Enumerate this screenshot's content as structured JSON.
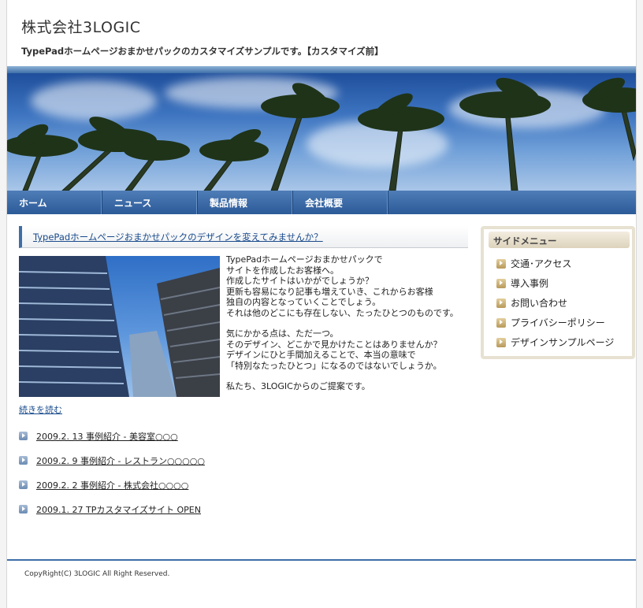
{
  "site": {
    "title": "株式会社3LOGIC",
    "description": "TypePadホームページおまかせパックのカスタマイズサンプルです。【カスタマイズ前】"
  },
  "nav": {
    "items": [
      {
        "label": "ホーム"
      },
      {
        "label": "ニュース"
      },
      {
        "label": "製品情報"
      },
      {
        "label": "会社概要"
      }
    ]
  },
  "post": {
    "title": "TypePadホームページおまかせパックのデザインを変えてみませんか？",
    "lines_p1": [
      "TypePadホームページおまかせパックで",
      "サイトを作成したお客様へ。",
      "作成したサイトはいかがでしょうか？",
      "更新も容易になり記事も増えていき、これからお客様",
      "独自の内容となっていくことでしょう。",
      "それは他のどこにも存在しない、たったひとつのものです。"
    ],
    "lines_p2": [
      "気にかかる点は、ただ一つ。",
      "そのデザイン、どこかで見かけたことはありませんか？",
      "デザインにひと手間加えることで、本当の意味で",
      "「特別なたったひとつ」になるのではないでしょうか。"
    ],
    "lines_p3": [
      "私たち、3LOGICからのご提案です。"
    ],
    "read_more": "続きを読む"
  },
  "news": [
    {
      "text": "2009.2. 13  事例紹介 - 美容室○○○"
    },
    {
      "text": "2009.2. 9   事例紹介 - レストラン○○○○○"
    },
    {
      "text": "2009.2. 2   事例紹介 - 株式会社○○○○"
    },
    {
      "text": "2009.1. 27  TPカスタマイズサイト  OPEN"
    }
  ],
  "sidebar": {
    "heading": "サイドメニュー",
    "items": [
      {
        "label": "交通･アクセス"
      },
      {
        "label": "導入事例"
      },
      {
        "label": "お問い合わせ"
      },
      {
        "label": "プライバシーポリシー"
      },
      {
        "label": "デザインサンプルページ"
      }
    ]
  },
  "footer": {
    "copyright": "CopyRight(C) 3LOGIC All Right Reserved."
  },
  "colors": {
    "accent": "#3d6ea8",
    "nav": "#2b5a98",
    "sidebar_border": "#e7e1d1",
    "link": "#1a4b8c"
  }
}
